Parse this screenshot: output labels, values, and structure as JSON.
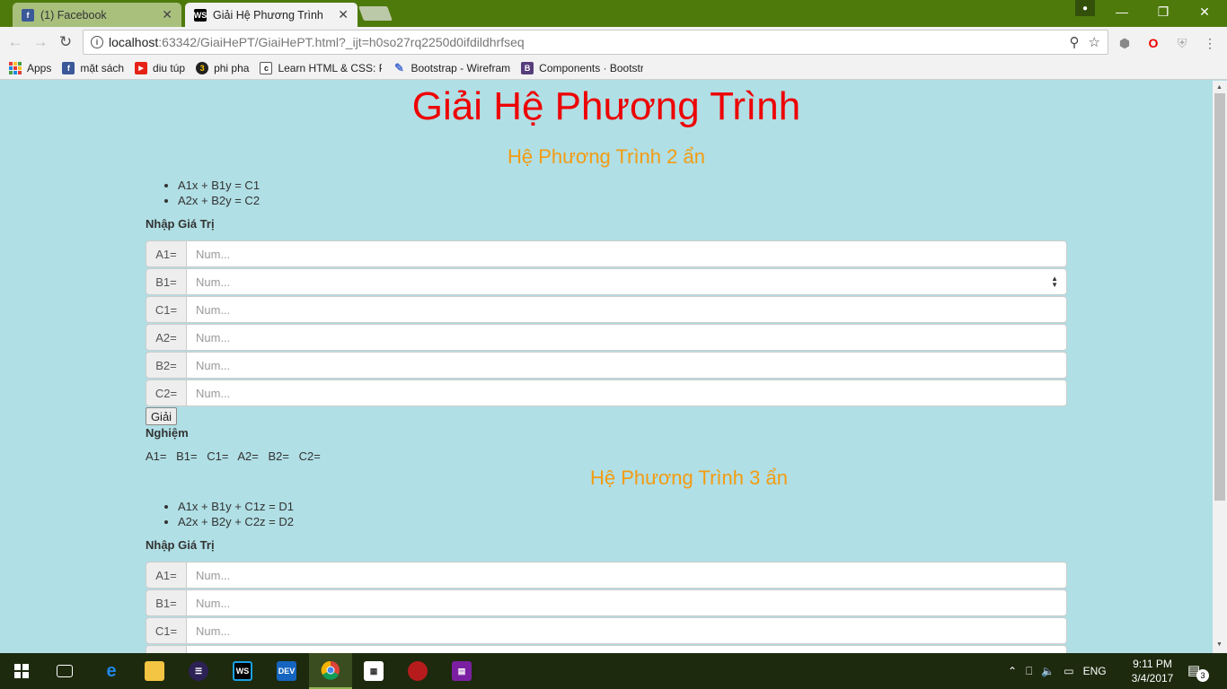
{
  "browser": {
    "tabs": [
      {
        "title": "(1) Facebook",
        "icon": "facebook-icon",
        "active": false
      },
      {
        "title": "Giải Hệ Phương Trình",
        "icon": "webstorm-icon",
        "active": true
      }
    ],
    "address": {
      "host": "localhost",
      "rest": ":63342/GiaiHePT/GiaiHePT.html?_ijt=h0so27rq2250d0ifdildhrfseq"
    },
    "bookmarks": [
      {
        "label": "Apps",
        "icon": "apps-grid-icon"
      },
      {
        "label": "mặt sách",
        "icon": "facebook-icon",
        "color": "#3b5998",
        "glyph": "f"
      },
      {
        "label": "diu túp",
        "icon": "youtube-icon",
        "color": "#e62117",
        "glyph": "▶"
      },
      {
        "label": "phi pha",
        "icon": "three-icon",
        "color": "#222222",
        "glyph": "3"
      },
      {
        "label": "Learn HTML & CSS: Pa",
        "icon": "codecademy-icon",
        "color": "#ffffff",
        "glyph": "c"
      },
      {
        "label": "Bootstrap - Wirefram",
        "icon": "pencil-icon",
        "color": "#ffffff",
        "glyph": "✎"
      },
      {
        "label": "Components · Bootstr",
        "icon": "bootstrap-icon",
        "color": "#563d7c",
        "glyph": "B"
      }
    ]
  },
  "page": {
    "title": "Giải Hệ Phương Trình",
    "section2": {
      "title": "Hệ Phương Trình 2 ẩn",
      "equations": [
        "A1x + B1y = C1",
        "A2x + B2y = C2"
      ],
      "input_label": "Nhập Giá Trị",
      "fields": [
        {
          "label": "A1=",
          "placeholder": "Num..."
        },
        {
          "label": "B1=",
          "placeholder": "Num..."
        },
        {
          "label": "C1=",
          "placeholder": "Num..."
        },
        {
          "label": "A2=",
          "placeholder": "Num..."
        },
        {
          "label": "B2=",
          "placeholder": "Num..."
        },
        {
          "label": "C2=",
          "placeholder": "Num..."
        }
      ],
      "solve_button": "Giải",
      "result_label": "Nghiệm",
      "results": [
        "A1=",
        "B1=",
        "C1=",
        "A2=",
        "B2=",
        "C2="
      ]
    },
    "section3": {
      "title": "Hệ Phương Trình 3 ẩn",
      "equations": [
        "A1x + B1y + C1z = D1",
        "A2x + B2y + C2z = D2"
      ],
      "input_label": "Nhập Giá Trị",
      "fields": [
        {
          "label": "A1=",
          "placeholder": "Num..."
        },
        {
          "label": "B1=",
          "placeholder": "Num..."
        },
        {
          "label": "C1=",
          "placeholder": "Num..."
        }
      ]
    }
  },
  "taskbar": {
    "input_language": "ENG",
    "time": "9:11 PM",
    "date": "3/4/2017",
    "notification_count": "3"
  },
  "colors": {
    "page_bg": "#b0dfe5",
    "title": "#ee0000",
    "subtitle": "#f39c12",
    "browser_frame": "#4e7a0c"
  }
}
